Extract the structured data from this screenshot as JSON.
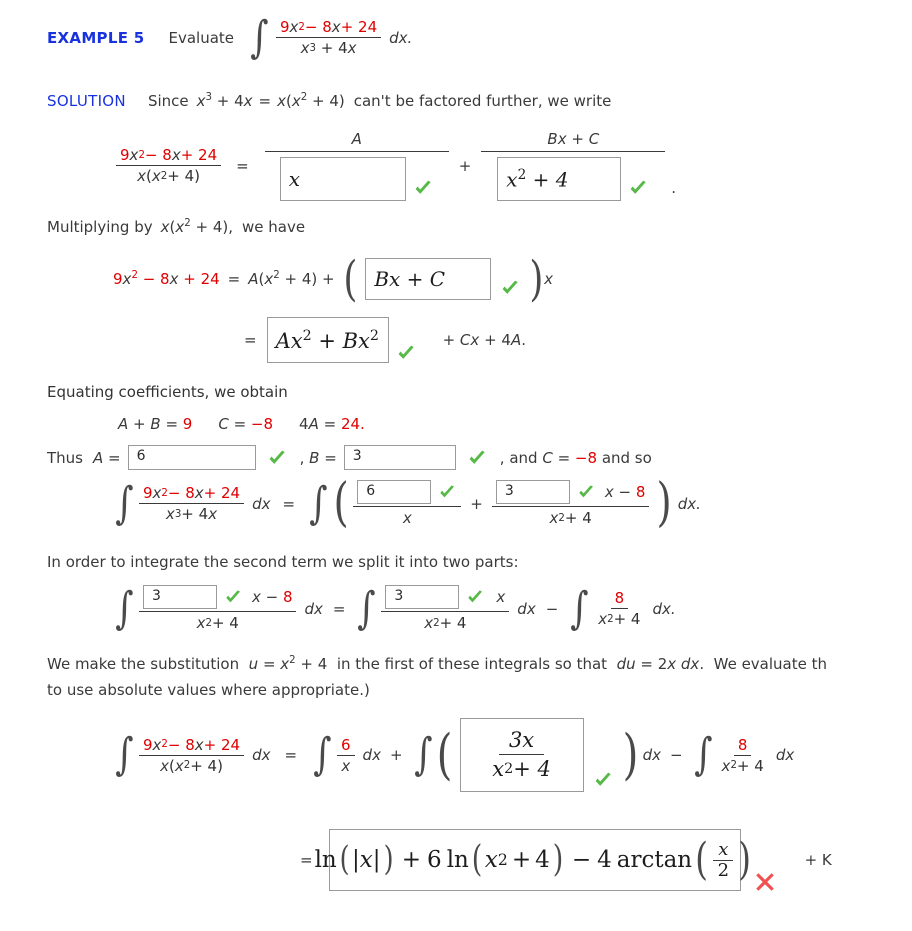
{
  "page": {
    "title": "Example 5 — Evaluate the integral (partial fractions)",
    "heading": "EXAMPLE 5",
    "heading_color": "#1832e0",
    "prompt": "Evaluate",
    "solution_label": "SOLUTION",
    "accent_red": "#e00000",
    "correct_color": "#57b947",
    "incorrect_color": "#f05050"
  },
  "icons": {
    "correct": "check-icon",
    "incorrect": "cross-icon",
    "integral": "integral-sign-icon"
  },
  "problem": {
    "numerator": "9x² − 8x + 24",
    "denominator": "x³ + 4x",
    "differential": "dx.",
    "n_a": "9",
    "n_b": "8",
    "n_c": "24",
    "den_pow": "3",
    "den_lin": "4x"
  },
  "line_solution": {
    "since": "Since",
    "expr_left": "x³ + 4x",
    "equals": "=",
    "expr_right": "x(x² + 4)",
    "tail": "can't be factored further, we write"
  },
  "setup": {
    "lhs_num": "9x² − 8x + 24",
    "lhs_den": "x(x² + 4)",
    "equals": "=",
    "label_a": "A",
    "plus": "+",
    "label_bc": "Bx + C",
    "period": ".",
    "box_a_value": "x",
    "box_a_status": "correct",
    "box_bc_value": "x² + 4",
    "box_bc_status": "correct"
  },
  "multiply": {
    "text_pre": "Multiplying by",
    "expr": "x(x² + 4),",
    "text_post": "we have",
    "eq_lhs": "9x² − 8x + 24",
    "eq_mid": "= A(x² + 4) +",
    "box1_value": "Bx + C",
    "box1_status": "correct",
    "trailing_x": "x",
    "eq2_equals": "=",
    "box2_value": "Ax² + Bx²",
    "box2_status": "correct",
    "eq2_tail": "+ Cx + 4A."
  },
  "coefficients": {
    "intro": "Equating coefficients, we obtain",
    "eq1_lhs": "A + B =",
    "eq1_rhs": "9",
    "eq2_lhs": "C =",
    "eq2_rhs": "−8",
    "eq3_lhs": "4A =",
    "eq3_rhs": "24.",
    "thus": "Thus",
    "label_a": "A =",
    "value_a": "6",
    "status_a": "correct",
    "comma_b": ", B =",
    "value_b": "3",
    "status_b": "correct",
    "tail": ", and C = −8 and so"
  },
  "integral_split": {
    "lhs_num": "9x² − 8x + 24",
    "lhs_den": "x³ + 4x",
    "dx": "dx",
    "equals": "=",
    "box1_value": "6",
    "box1_status": "correct",
    "den1": "x",
    "plus": "+",
    "box2_value": "3",
    "box2_status": "correct",
    "num2_tail": "x − 8",
    "den2": "x² + 4",
    "dx_end": "dx."
  },
  "split_text": "In order to integrate the second term we split it into two parts:",
  "split_eq": {
    "box1_value": "3",
    "box1_status": "correct",
    "num1_tail": "x − 8",
    "den1": "x² + 4",
    "dx1": "dx",
    "equals": "=",
    "box2_value": "3",
    "box2_status": "correct",
    "num2_tail": "x",
    "den2": "x² + 4",
    "dx2": "dx",
    "minus": "−",
    "num3": "8",
    "den3": "x² + 4",
    "dx3": "dx."
  },
  "substitution": {
    "line1": "We make the substitution  u = x² + 4  in the first of these integrals so that  du = 2x dx.  We evaluate th",
    "line2": "to use absolute values where appropriate.)"
  },
  "final_integral": {
    "lhs_num": "9x² − 8x + 24",
    "lhs_den": "x(x² + 4)",
    "dx": "dx",
    "equals": "=",
    "term1_num": "6",
    "term1_den": "x",
    "dx1": "dx",
    "plus": "+",
    "box_num": "3x",
    "box_den": "x² + 4",
    "box_status": "correct",
    "dx2": "dx",
    "minus": "−",
    "term3_num": "8",
    "term3_den": "x² + 4",
    "dx3": "dx"
  },
  "answer": {
    "equals": "=",
    "expression": "ln( |x| ) + 6 ln(x² + 4) − 4 arctan( x/2 )",
    "parts": {
      "ln_open": "ln",
      "abs_x": "|x|",
      "plus": "+",
      "coef6": "6",
      "ln2": "ln",
      "inner2": "x² + 4",
      "minus": "−",
      "coef4": "4",
      "arctan": "arctan",
      "frac_num": "x",
      "frac_den": "2"
    },
    "status": "incorrect",
    "constant": "+ K"
  }
}
